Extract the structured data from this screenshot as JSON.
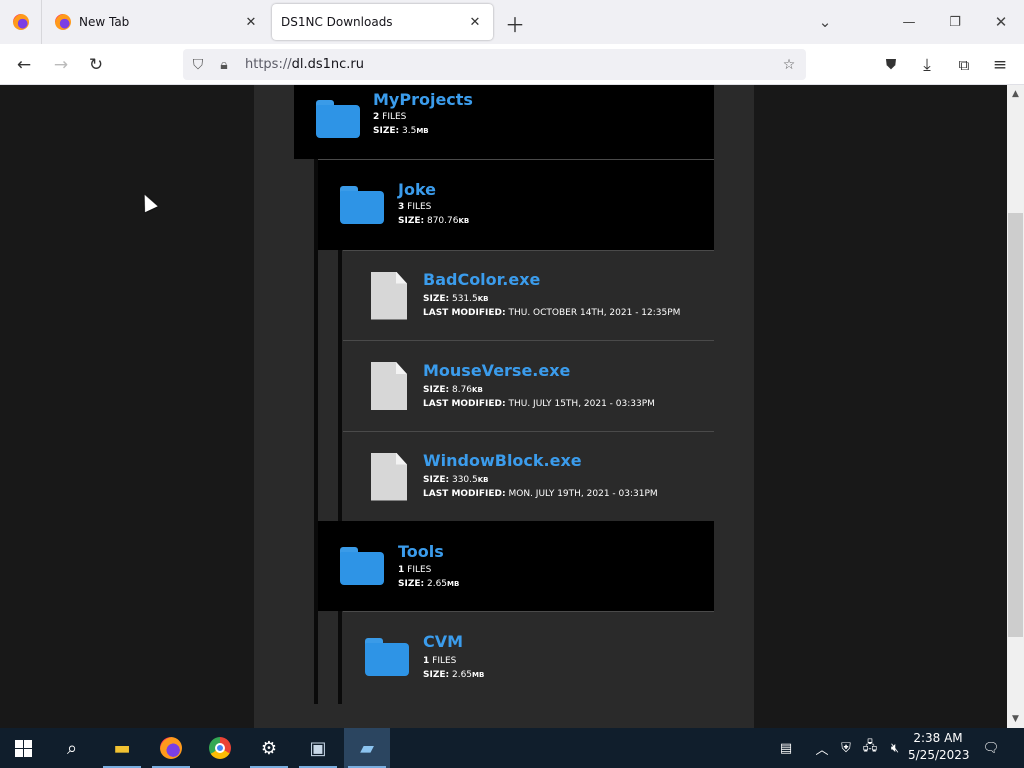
{
  "browser": {
    "tabs": [
      {
        "title": "New Tab"
      },
      {
        "title": "DS1NC Downloads"
      }
    ],
    "url": {
      "scheme": "https://",
      "host_prefix": "dl.",
      "host": "ds1nc.ru"
    }
  },
  "tree": {
    "my_projects": {
      "name": "MyProjects",
      "files_count": "2",
      "files_label": "FILES",
      "size_label": "SIZE:",
      "size": "3.5",
      "size_unit": "MB"
    },
    "joke": {
      "name": "Joke",
      "files_count": "3",
      "files_label": "FILES",
      "size_label": "SIZE:",
      "size": "870.76",
      "size_unit": "KB"
    },
    "files_joke": [
      {
        "name": "BadColor.exe",
        "size_label": "SIZE:",
        "size": "531.5",
        "size_unit": "KB",
        "modified_label": "LAST MODIFIED:",
        "modified": "THU. OCTOBER 14TH, 2021 - 12:35PM"
      },
      {
        "name": "MouseVerse.exe",
        "size_label": "SIZE:",
        "size": "8.76",
        "size_unit": "KB",
        "modified_label": "LAST MODIFIED:",
        "modified": "THU. JULY 15TH, 2021 - 03:33PM"
      },
      {
        "name": "WindowBlock.exe",
        "size_label": "SIZE:",
        "size": "330.5",
        "size_unit": "KB",
        "modified_label": "LAST MODIFIED:",
        "modified": "MON. JULY 19TH, 2021 - 03:31PM"
      }
    ],
    "tools": {
      "name": "Tools",
      "files_count": "1",
      "files_label": "FILES",
      "size_label": "SIZE:",
      "size": "2.65",
      "size_unit": "MB"
    },
    "cvm": {
      "name": "CVM",
      "files_count": "1",
      "files_label": "FILES",
      "size_label": "SIZE:",
      "size": "2.65",
      "size_unit": "MB"
    }
  },
  "taskbar": {
    "icons": [
      "windows-start-icon",
      "search-icon",
      "file-explorer-icon",
      "firefox-icon",
      "chrome-icon",
      "settings-icon",
      "control-panel-icon",
      "app-window-icon"
    ],
    "clock": {
      "time": "2:38 AM",
      "date": "5/25/2023"
    }
  },
  "colors": {
    "link": "#3b9cec",
    "folder": "#2e94e6",
    "row_bg": "#000000",
    "page_bg": "#2a2a2a",
    "taskbar": "#101e2c"
  }
}
